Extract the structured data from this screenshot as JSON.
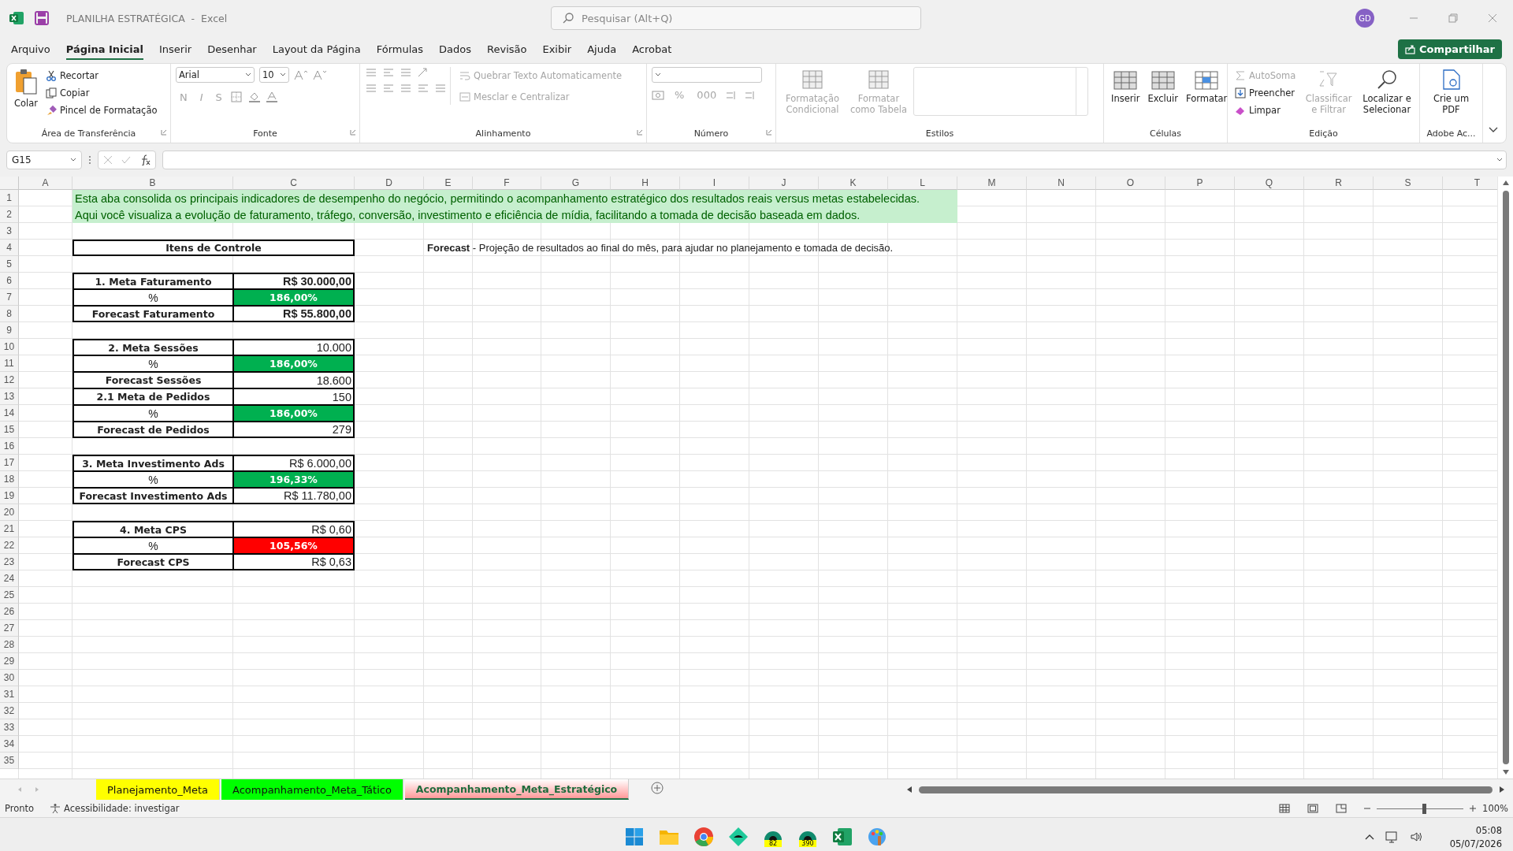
{
  "title_bar": {
    "title": "PLANILHA ESTRATÉGICA  -  Excel",
    "search_placeholder": "Pesquisar (Alt+Q)",
    "avatar": "GD"
  },
  "menu_tabs": [
    {
      "label": "Arquivo",
      "selected": false
    },
    {
      "label": "Página Inicial",
      "selected": true
    },
    {
      "label": "Inserir",
      "selected": false
    },
    {
      "label": "Desenhar",
      "selected": false
    },
    {
      "label": "Layout da Página",
      "selected": false
    },
    {
      "label": "Fórmulas",
      "selected": false
    },
    {
      "label": "Dados",
      "selected": false
    },
    {
      "label": "Revisão",
      "selected": false
    },
    {
      "label": "Exibir",
      "selected": false
    },
    {
      "label": "Ajuda",
      "selected": false
    },
    {
      "label": "Acrobat",
      "selected": false
    }
  ],
  "share_button": "Compartilhar",
  "ribbon": {
    "groups": [
      {
        "kind": "clipboard",
        "label": "Área de Transferência",
        "controls": [
          {
            "kind": "large",
            "label": "Colar",
            "disabled": false
          },
          {
            "kind": "small",
            "label": "Recortar",
            "disabled": false
          },
          {
            "kind": "small",
            "label": "Copiar",
            "disabled": false
          },
          {
            "kind": "small",
            "label": "Pincel de Formatação",
            "disabled": false
          }
        ]
      },
      {
        "kind": "font",
        "label": "Fonte",
        "controls": [
          {
            "kind": "field",
            "label": "Arial",
            "disabled": false
          },
          {
            "kind": "field",
            "label": "10",
            "disabled": false
          },
          {
            "kind": "glyph",
            "label": "N",
            "disabled": true
          },
          {
            "kind": "glyph",
            "label": "I",
            "disabled": true
          },
          {
            "kind": "glyph",
            "label": "S",
            "disabled": true
          }
        ]
      },
      {
        "kind": "alignment",
        "label": "Alinhamento",
        "controls": [
          {
            "kind": "small",
            "label": "Quebrar Texto Automaticamente",
            "disabled": true
          },
          {
            "kind": "small",
            "label": "Mesclar e Centralizar",
            "disabled": true
          }
        ]
      },
      {
        "kind": "number",
        "label": "Número",
        "controls": [
          {
            "kind": "glyph",
            "label": "%",
            "disabled": true
          },
          {
            "kind": "glyph",
            "label": "000",
            "disabled": true
          }
        ]
      },
      {
        "kind": "styles",
        "label": "Estilos",
        "controls": [
          {
            "kind": "large",
            "label": "Formatação Condicional",
            "disabled": true
          },
          {
            "kind": "large",
            "label": "Formatar como Tabela",
            "disabled": true
          }
        ]
      },
      {
        "kind": "cells",
        "label": "Células",
        "controls": [
          {
            "kind": "large",
            "label": "Inserir",
            "disabled": false
          },
          {
            "kind": "large",
            "label": "Excluir",
            "disabled": false
          },
          {
            "kind": "large",
            "label": "Formatar",
            "disabled": false
          }
        ]
      },
      {
        "kind": "editing",
        "label": "Edição",
        "controls": [
          {
            "kind": "small",
            "label": "AutoSoma",
            "disabled": true
          },
          {
            "kind": "small",
            "label": "Preencher",
            "disabled": false
          },
          {
            "kind": "small",
            "label": "Limpar",
            "disabled": false
          },
          {
            "kind": "large",
            "label": "Classificar e Filtrar",
            "disabled": true
          },
          {
            "kind": "large",
            "label": "Localizar e Selecionar",
            "disabled": false
          }
        ]
      },
      {
        "kind": "adobe",
        "label": "Adobe Ac...",
        "controls": [
          {
            "kind": "large",
            "label": "Crie um PDF",
            "disabled": false
          }
        ]
      }
    ]
  },
  "name_box": "G15",
  "columns": [
    "A",
    "B",
    "C",
    "D",
    "E",
    "F",
    "G",
    "H",
    "I",
    "J",
    "K",
    "L",
    "M",
    "N",
    "O",
    "P",
    "Q",
    "R",
    "S",
    "T"
  ],
  "rows": [
    "1",
    "2",
    "3",
    "4",
    "5",
    "6",
    "7",
    "8",
    "9",
    "10",
    "11",
    "12",
    "13",
    "14",
    "15",
    "16",
    "17",
    "18",
    "19",
    "20",
    "21",
    "22",
    "23",
    "24",
    "25",
    "26",
    "27",
    "28",
    "29",
    "30",
    "31",
    "32",
    "33",
    "34",
    "35"
  ],
  "intro": [
    "Esta aba consolida os principais indicadores de desempenho do negócio, permitindo o acompanhamento estratégico dos resultados reais versus metas estabelecidas.",
    "Aqui você visualiza a evolução de faturamento, tráfego, conversão, investimento e eficiência de mídia, facilitando a tomada de decisão baseada em dados."
  ],
  "forecast_note": "**Forecast** - Projeção de resultados ao final do mês, para ajudar no planejamento e tomada de decisão.",
  "control_table": {
    "title": "Itens de Controle",
    "groups": [
      {
        "rows": [
          {
            "kind": "goal",
            "label": "1. Meta Faturamento",
            "value": "R$ 30.000,00",
            "value_bold": true
          },
          {
            "kind": "percent",
            "label": "%",
            "value": "186,00%",
            "color": "#00b050"
          },
          {
            "kind": "goal",
            "label": "Forecast Faturamento",
            "value": "R$ 55.800,00",
            "value_bold": true
          }
        ]
      },
      {
        "rows": [
          {
            "kind": "goal",
            "label": "2. Meta Sessões",
            "value": "10.000",
            "value_bold": false
          },
          {
            "kind": "percent",
            "label": "%",
            "value": "186,00%",
            "color": "#00b050"
          },
          {
            "kind": "goal",
            "label": "Forecast Sessões",
            "value": "18.600",
            "value_bold": false
          },
          {
            "kind": "goal",
            "label": "2.1 Meta de Pedidos",
            "value": "150",
            "value_bold": false
          },
          {
            "kind": "percent",
            "label": "%",
            "value": "186,00%",
            "color": "#00b050"
          },
          {
            "kind": "goal",
            "label": "Forecast de Pedidos",
            "value": "279",
            "value_bold": false
          }
        ]
      },
      {
        "rows": [
          {
            "kind": "goal",
            "label": "3. Meta Investimento Ads",
            "value": "R$ 6.000,00",
            "value_bold": false
          },
          {
            "kind": "percent",
            "label": "%",
            "value": "196,33%",
            "color": "#00b050"
          },
          {
            "kind": "goal",
            "label": "Forecast Investimento Ads",
            "value": "R$ 11.780,00",
            "value_bold": false
          }
        ]
      },
      {
        "rows": [
          {
            "kind": "goal",
            "label": "4. Meta CPS",
            "value": "R$ 0,60",
            "value_bold": false
          },
          {
            "kind": "percent",
            "label": "%",
            "value": "105,56%",
            "color": "#ff0000"
          },
          {
            "kind": "goal",
            "label": "Forecast CPS",
            "value": "R$ 0,63",
            "value_bold": false
          }
        ]
      }
    ]
  },
  "sheet_tabs": [
    {
      "label": "Planejamento_Meta",
      "color": "#ffff00",
      "selected": false
    },
    {
      "label": "Acompanhamento_Meta_Tático",
      "color": "#00ff00",
      "selected": false
    },
    {
      "label": "Acompanhamento_Meta_Estratégico",
      "color": "#ff9999",
      "selected": true
    }
  ],
  "status_bar": {
    "text": "Pronto",
    "accessibility": "Acessibilidade: investigar",
    "zoom": {
      "level": 0.55,
      "reading": "100%"
    }
  },
  "taskbar": {
    "apps": [
      {
        "kind": "start"
      },
      {
        "kind": "folder"
      },
      {
        "kind": "browser"
      },
      {
        "kind": "app"
      },
      {
        "kind": "badged",
        "badge": "82"
      },
      {
        "kind": "badged",
        "badge": "390"
      },
      {
        "kind": "excel"
      },
      {
        "kind": "paint"
      }
    ],
    "time": "05:08",
    "date": "05/07/2026"
  }
}
